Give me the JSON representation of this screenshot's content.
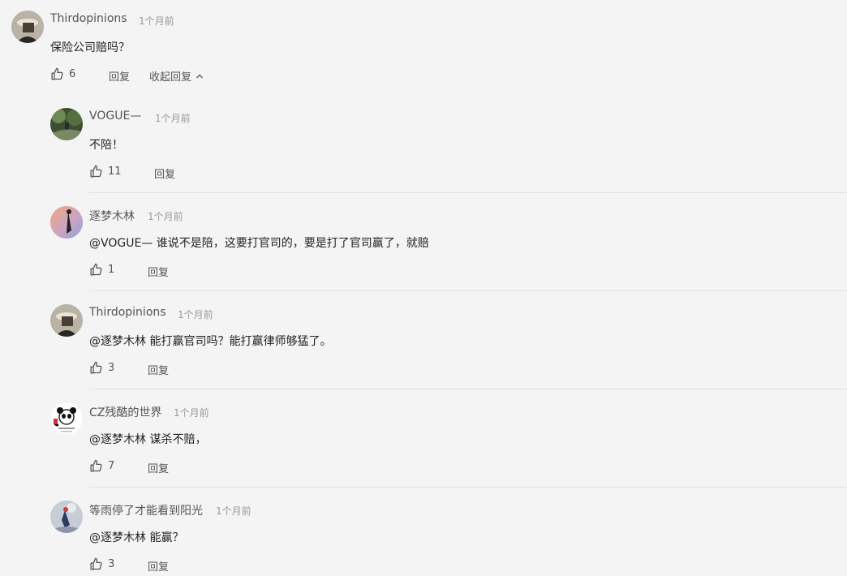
{
  "top": {
    "name": "Thirdopinions",
    "time": "1个月前",
    "text": "保险公司赔吗？",
    "likes": "6",
    "reply_label": "回复",
    "collapse_label": "收起回复"
  },
  "replies": [
    {
      "name": "VOGUE—",
      "time": "1个月前",
      "text": "不陪！",
      "likes": "11",
      "reply_label": "回复"
    },
    {
      "name": "逐梦木林",
      "time": "1个月前",
      "text": "@VOGUE— 谁说不是陪，这要打官司的，要是打了官司赢了，就赔",
      "likes": "1",
      "reply_label": "回复"
    },
    {
      "name": "Thirdopinions",
      "time": "1个月前",
      "text": "@逐梦木林 能打赢官司吗？能打赢律师够猛了。",
      "likes": "3",
      "reply_label": "回复"
    },
    {
      "name": "CZ残酷的世界",
      "time": "1个月前",
      "text": "@逐梦木林 谋杀不赔，",
      "likes": "7",
      "reply_label": "回复"
    },
    {
      "name": "等雨停了才能看到阳光",
      "time": "1个月前",
      "text": "@逐梦木林 能赢？",
      "likes": "3",
      "reply_label": "回复"
    }
  ]
}
